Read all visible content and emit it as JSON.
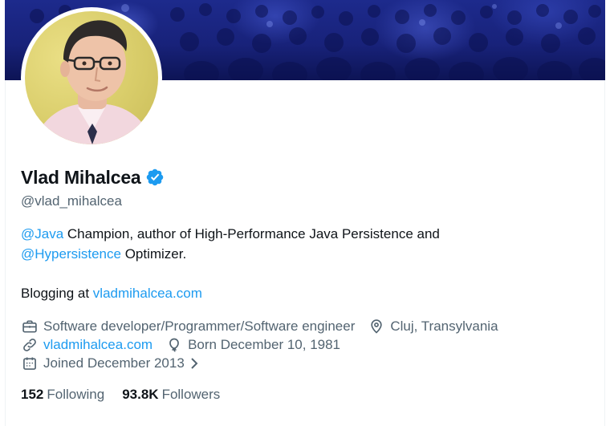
{
  "profile": {
    "name": "Vlad Mihalcea",
    "handle": "@vlad_mihalcea",
    "verified": true
  },
  "bio": {
    "line1_mention": "@Java",
    "line1_text": " Champion, author of High-Performance Java Persistence and",
    "line2_mention": "@Hypersistence",
    "line2_text": " Optimizer.",
    "line3_text": "Blogging at ",
    "line3_link": "vladmihalcea.com"
  },
  "meta": {
    "profession": "Software developer/Programmer/Software engineer",
    "location": "Cluj, Transylvania",
    "website": "vladmihalcea.com",
    "birthday": "Born December 10, 1981",
    "joined": "Joined December 2013"
  },
  "stats": {
    "following_count": "152",
    "following_label": "Following",
    "followers_count": "93.8K",
    "followers_label": "Followers"
  },
  "colors": {
    "accent": "#1d9bf0",
    "text_primary": "#0f1419",
    "text_secondary": "#536471",
    "banner": "#1d2a8c"
  },
  "icons": {
    "verified": "verified-badge-icon",
    "profession": "briefcase-icon",
    "location": "location-pin-icon",
    "website": "link-icon",
    "birthday": "balloon-icon",
    "joined": "calendar-icon",
    "joined_more": "chevron-right-icon"
  }
}
